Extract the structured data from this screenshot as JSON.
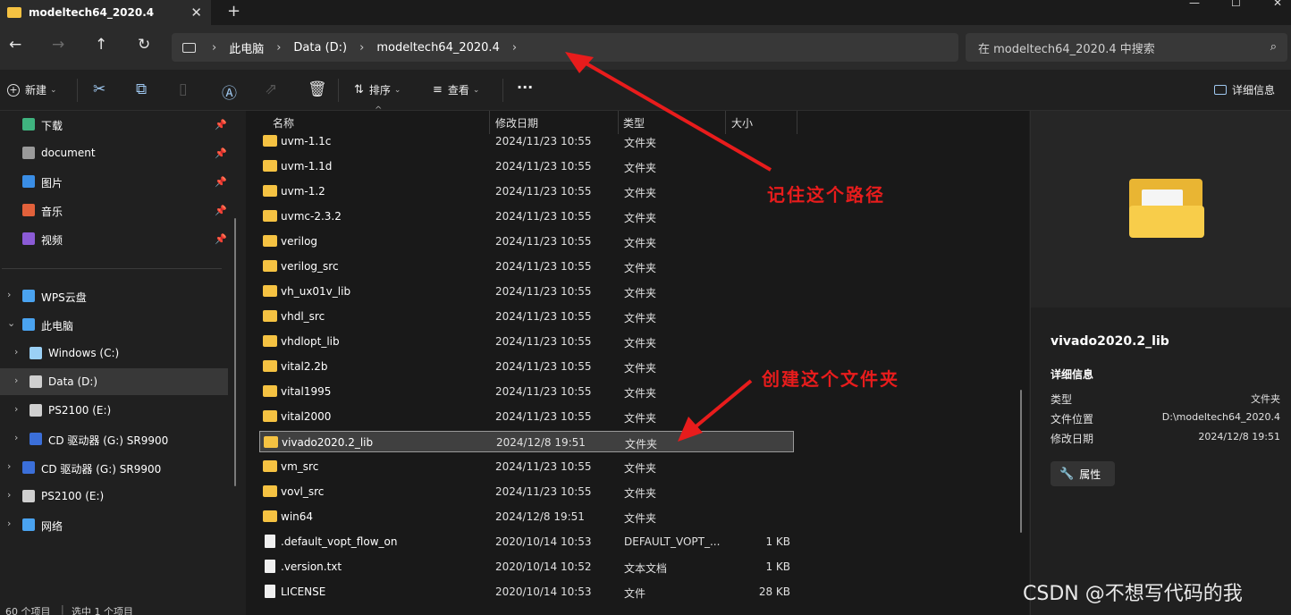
{
  "window": {
    "tab_title": "modeltech64_2020.4",
    "tab_close": "✕",
    "new_tab": "+",
    "minimize": "—",
    "maximize": "☐",
    "close": "✕"
  },
  "nav": {
    "back": "←",
    "forward": "→",
    "up": "↑",
    "refresh": "↻",
    "breadcrumb": [
      "此电脑",
      "Data (D:)",
      "modeltech64_2020.4"
    ],
    "sep": "›",
    "search_placeholder": "在 modeltech64_2020.4 中搜索",
    "search_icon": "⌕"
  },
  "toolbar": {
    "new_label": "新建",
    "sort_label": "排序",
    "view_label": "查看",
    "more": "···",
    "details_label": "详细信息",
    "icons": [
      "cut-icon",
      "copy-icon",
      "paste-icon",
      "rename-icon",
      "share-icon",
      "delete-icon"
    ]
  },
  "sidebar": {
    "quick": [
      {
        "label": "下载",
        "icon": "download-icon",
        "color": "#3fb37f"
      },
      {
        "label": "document",
        "icon": "document-icon",
        "color": "#9a9a9a"
      },
      {
        "label": "图片",
        "icon": "pictures-icon",
        "color": "#3a8ee6"
      },
      {
        "label": "音乐",
        "icon": "music-icon",
        "color": "#e2613b"
      },
      {
        "label": "视频",
        "icon": "videos-icon",
        "color": "#8b5bd6"
      }
    ],
    "tree": [
      {
        "label": "WPS云盘",
        "icon": "cloud-icon",
        "color": "#4aa3f0"
      },
      {
        "label": "此电脑",
        "icon": "pc-icon",
        "color": "#4aa3f0"
      },
      {
        "label": "Windows (C:)",
        "icon": "drive-icon",
        "color": "#9ad0f5"
      },
      {
        "label": "Data (D:)",
        "icon": "drive-icon",
        "color": "#cfcfcf"
      },
      {
        "label": "PS2100 (E:)",
        "icon": "drive-icon",
        "color": "#cfcfcf"
      },
      {
        "label": "CD 驱动器 (G:) SR9900",
        "icon": "cd-icon",
        "color": "#3b6fd9"
      },
      {
        "label": "CD 驱动器 (G:) SR9900",
        "icon": "cd-icon",
        "color": "#3b6fd9"
      },
      {
        "label": "PS2100 (E:)",
        "icon": "drive-icon",
        "color": "#cfcfcf"
      },
      {
        "label": "网络",
        "icon": "network-icon",
        "color": "#4aa3f0"
      }
    ]
  },
  "columns": {
    "name": "名称",
    "date": "修改日期",
    "type": "类型",
    "size": "大小"
  },
  "files": [
    {
      "name": "uvm-1.1c",
      "date": "2024/11/23 10:55",
      "type": "文件夹",
      "size": "",
      "kind": "folder"
    },
    {
      "name": "uvm-1.1d",
      "date": "2024/11/23 10:55",
      "type": "文件夹",
      "size": "",
      "kind": "folder"
    },
    {
      "name": "uvm-1.2",
      "date": "2024/11/23 10:55",
      "type": "文件夹",
      "size": "",
      "kind": "folder"
    },
    {
      "name": "uvmc-2.3.2",
      "date": "2024/11/23 10:55",
      "type": "文件夹",
      "size": "",
      "kind": "folder"
    },
    {
      "name": "verilog",
      "date": "2024/11/23 10:55",
      "type": "文件夹",
      "size": "",
      "kind": "folder"
    },
    {
      "name": "verilog_src",
      "date": "2024/11/23 10:55",
      "type": "文件夹",
      "size": "",
      "kind": "folder"
    },
    {
      "name": "vh_ux01v_lib",
      "date": "2024/11/23 10:55",
      "type": "文件夹",
      "size": "",
      "kind": "folder"
    },
    {
      "name": "vhdl_src",
      "date": "2024/11/23 10:55",
      "type": "文件夹",
      "size": "",
      "kind": "folder"
    },
    {
      "name": "vhdlopt_lib",
      "date": "2024/11/23 10:55",
      "type": "文件夹",
      "size": "",
      "kind": "folder"
    },
    {
      "name": "vital2.2b",
      "date": "2024/11/23 10:55",
      "type": "文件夹",
      "size": "",
      "kind": "folder"
    },
    {
      "name": "vital1995",
      "date": "2024/11/23 10:55",
      "type": "文件夹",
      "size": "",
      "kind": "folder"
    },
    {
      "name": "vital2000",
      "date": "2024/11/23 10:55",
      "type": "文件夹",
      "size": "",
      "kind": "folder"
    },
    {
      "name": "vivado2020.2_lib",
      "date": "2024/12/8 19:51",
      "type": "文件夹",
      "size": "",
      "kind": "folder",
      "selected": true
    },
    {
      "name": "vm_src",
      "date": "2024/11/23 10:55",
      "type": "文件夹",
      "size": "",
      "kind": "folder"
    },
    {
      "name": "vovl_src",
      "date": "2024/11/23 10:55",
      "type": "文件夹",
      "size": "",
      "kind": "folder"
    },
    {
      "name": "win64",
      "date": "2024/12/8 19:51",
      "type": "文件夹",
      "size": "",
      "kind": "folder"
    },
    {
      "name": ".default_vopt_flow_on",
      "date": "2020/10/14 10:53",
      "type": "DEFAULT_VOPT_...",
      "size": "1 KB",
      "kind": "file"
    },
    {
      "name": ".version.txt",
      "date": "2020/10/14 10:52",
      "type": "文本文档",
      "size": "1 KB",
      "kind": "file"
    },
    {
      "name": "LICENSE",
      "date": "2020/10/14 10:53",
      "type": "文件",
      "size": "28 KB",
      "kind": "file"
    }
  ],
  "annotations": {
    "remember_path": "记住这个路径",
    "create_folder": "创建这个文件夹",
    "color": "#e81c1c"
  },
  "details": {
    "name": "vivado2020.2_lib",
    "heading": "详细信息",
    "rows": [
      {
        "key": "类型",
        "value": "文件夹"
      },
      {
        "key": "文件位置",
        "value": "D:\\modeltech64_2020.4"
      },
      {
        "key": "修改日期",
        "value": "2024/12/8 19:51"
      }
    ],
    "properties_label": "属性"
  },
  "status": {
    "count": "60 个项目",
    "selected": "选中 1 个项目"
  },
  "watermark": "CSDN @不想写代码的我"
}
